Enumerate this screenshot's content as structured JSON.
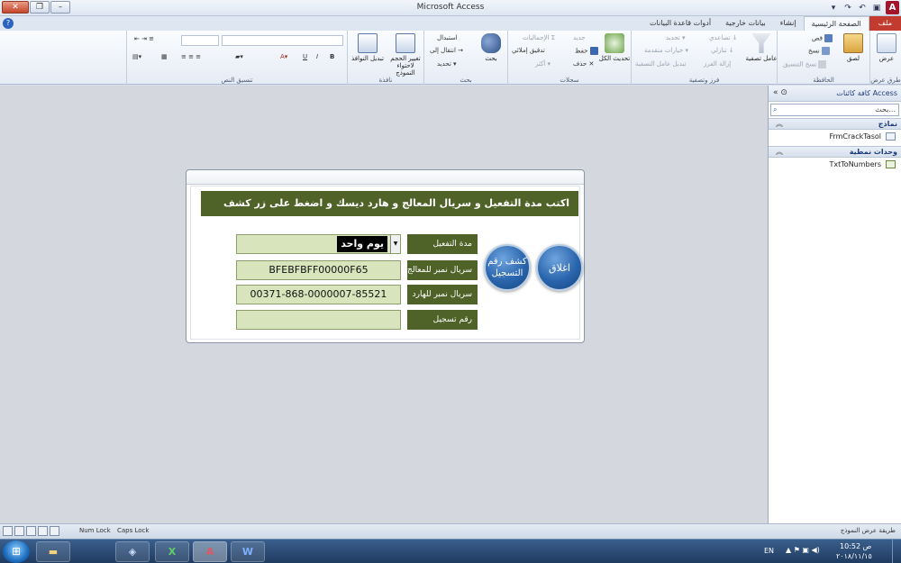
{
  "window": {
    "title": "Microsoft Access",
    "app_icon_letter": "A",
    "qat_icons": [
      "save-icon",
      "undo-icon",
      "redo-icon",
      "customize-icon"
    ]
  },
  "tabs": {
    "file": "ملف",
    "home": "الصفحة الرئيسية",
    "create": "إنشاء",
    "external": "بيانات خارجية",
    "dbtools": "أدوات قاعدة البيانات"
  },
  "ribbon": {
    "views": {
      "view_label": "عرض",
      "group_label": "طرق عرض"
    },
    "clipboard": {
      "paste": "لصق",
      "cut": "قص",
      "copy": "نسخ",
      "format_painter": "نسخ التنسيق",
      "group_label": "الحافظة"
    },
    "sort_filter": {
      "filter": "عامل تصفية",
      "ascending": "تصاعدي",
      "descending": "تنازلي",
      "remove_sort": "إزالة الفرز",
      "selection": "تحديد",
      "advanced": "خيارات متقدمة",
      "toggle_filter": "تبديل عامل التصفية",
      "group_label": "فرز وتصفية"
    },
    "records": {
      "refresh": "تحديث الكل",
      "new": "جديد",
      "save": "حفظ",
      "delete": "حذف",
      "totals": "الإجماليات",
      "spelling": "تدقيق إملائي",
      "more": "أكثر",
      "group_label": "سجلات"
    },
    "find": {
      "find": "بحث",
      "replace": "استبدال",
      "goto": "انتقال إلى",
      "select": "تحديد",
      "group_label": "بحث"
    },
    "window": {
      "size_to_fit": "تغيير الحجم لاحتواء النموذج",
      "switch": "تبديل النوافذ",
      "group_label": "نافذة"
    },
    "text_format": {
      "bold": "B",
      "italic": "I",
      "underline": "U",
      "group_label": "تنسيق النص"
    }
  },
  "nav": {
    "header": "كافة كائنات Access",
    "search_placeholder": "بحث...",
    "sections": [
      {
        "title": "نماذج",
        "items": [
          "FrmCrackTasol"
        ]
      },
      {
        "title": "وحدات نمطية",
        "items": [
          "TxtToNumbers"
        ]
      }
    ]
  },
  "form": {
    "header": "اكتب مدة التفعيل و سريال المعالج و هارد ديسك و اضغط على زر كشف رقم التسجيل",
    "fields": [
      {
        "label": "مدة التفعيل",
        "value": "يوم واحد"
      },
      {
        "label": "سريال نمبر للمعالج",
        "value": "BFEBFBFF00000F65"
      },
      {
        "label": "سريال نمبر للهارد",
        "value": "00371-868-0000007-85521"
      },
      {
        "label": "رقم تسجيل",
        "value": ""
      }
    ],
    "reveal_button": "كشف رقم التسجيل",
    "close_button": "اغلاق"
  },
  "statusbar": {
    "view_text": "طريقة عرض النموذج",
    "num_lock": "Num Lock",
    "caps_lock": "Caps Lock"
  },
  "taskbar": {
    "lang": "EN",
    "time": "10:52 ص",
    "date": "٢٠١٨/١١/١٥",
    "apps": [
      "explorer",
      "network",
      "excel",
      "access",
      "word"
    ]
  },
  "colors": {
    "form_label_bg": "#4f6228",
    "form_input_bg": "#d8e4bc",
    "file_tab": "#c23b2e",
    "button_blue": "#2a65ad"
  }
}
